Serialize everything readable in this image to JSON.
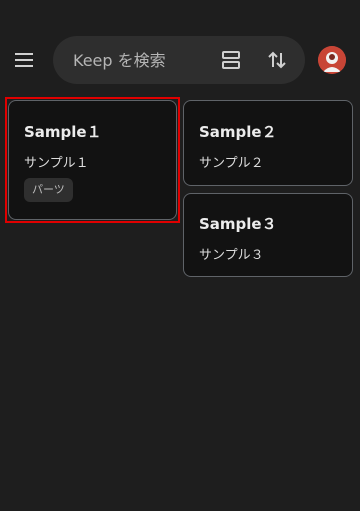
{
  "search": {
    "placeholder": "Keep を検索"
  },
  "icons": {
    "menu": "menu-icon",
    "view_toggle": "list-view-icon",
    "sort": "sort-icon",
    "avatar": "account-avatar"
  },
  "notes": [
    {
      "title": "Sample１",
      "body": "サンプル１",
      "label": "パーツ"
    },
    {
      "title": "Sample２",
      "body": "サンプル２"
    },
    {
      "title": "Sample３",
      "body": "サンプル３"
    }
  ],
  "colors": {
    "background": "#1e1e1e",
    "note": "#121212",
    "selection": "#e00000"
  }
}
